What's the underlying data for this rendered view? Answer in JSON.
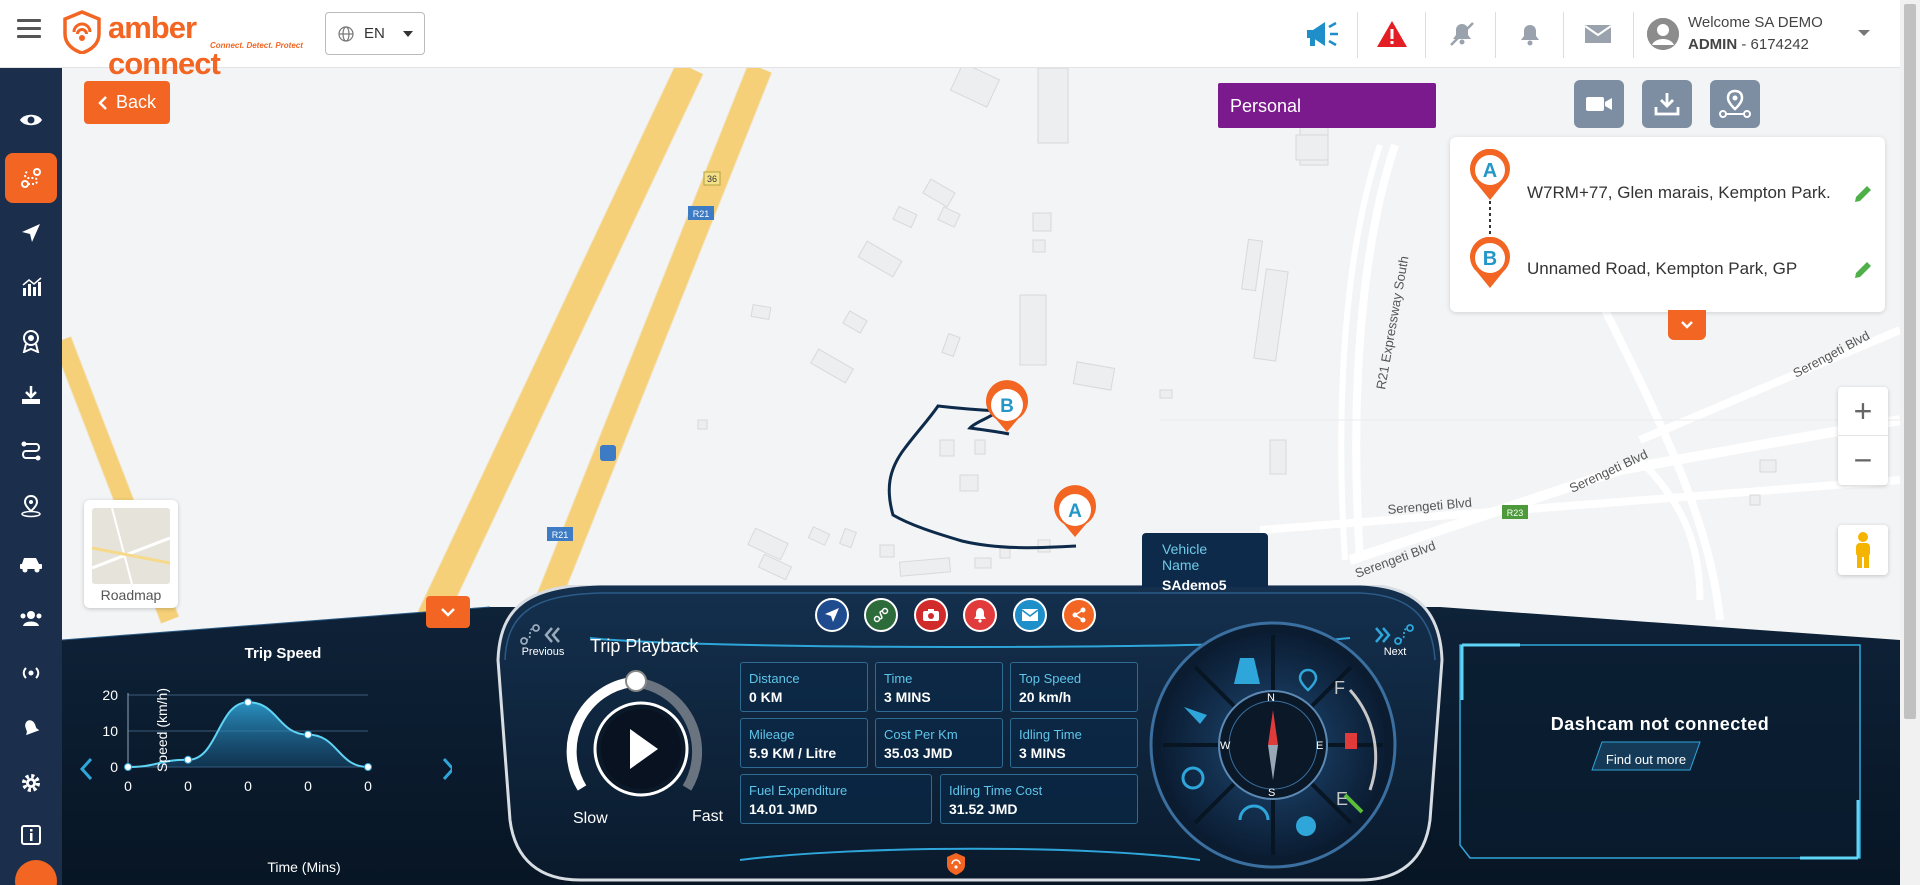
{
  "header": {
    "brand": "amber connect",
    "tagline": "Connect. Detect. Protect",
    "language": "EN",
    "welcome": "Welcome SA DEMO",
    "role": "ADMIN",
    "account": "- 6174242"
  },
  "map": {
    "back_label": "Back",
    "trip_tag": "Personal",
    "start_marker": "A",
    "end_marker": "B",
    "start_address": "W7RM+77, Glen marais, Kempton Park.",
    "end_address": "Unnamed Road, Kempton Park, GP",
    "roadmap_label": "Roadmap",
    "zoom_in": "+",
    "zoom_out": "−",
    "labels": {
      "r21_a": "R21",
      "r21_b": "R21",
      "r36": "36",
      "r21_express": "R21 Expressway South",
      "serengeti1": "Serengeti Blvd",
      "serengeti2": "Serengeti Blvd",
      "serengeti3": "Serengeti Blvd",
      "serengeti4": "Serengeti Blvd",
      "r23": "R23"
    }
  },
  "vehicle": {
    "label": "Vehicle Name",
    "name": "SAdemo5"
  },
  "chart_data": {
    "type": "line",
    "title": "Trip Speed",
    "xlabel": "Time (Mins)",
    "ylabel": "Speed (km/h)",
    "x": [
      "0",
      "0",
      "0",
      "0",
      "0"
    ],
    "values": [
      0,
      2,
      18,
      9,
      0
    ],
    "ylim": [
      0,
      20
    ],
    "yticks": [
      "0",
      "10",
      "20"
    ],
    "grid": true
  },
  "playback": {
    "title": "Trip Playback",
    "previous": "Previous",
    "next": "Next",
    "slow": "Slow",
    "fast": "Fast"
  },
  "stats": {
    "distance": {
      "label": "Distance",
      "value": "0 KM"
    },
    "time": {
      "label": "Time",
      "value": "3 MINS"
    },
    "top_speed": {
      "label": "Top Speed",
      "value": "20 km/h"
    },
    "mileage": {
      "label": "Mileage",
      "value": "5.9 KM / Litre"
    },
    "cost_per_km": {
      "label": "Cost Per Km",
      "value": "35.03 JMD"
    },
    "idling_time": {
      "label": "Idling Time",
      "value": "3 MINS"
    },
    "fuel_expenditure": {
      "label": "Fuel Expenditure",
      "value": "14.01 JMD"
    },
    "idling_cost": {
      "label": "Idling Time Cost",
      "value": "31.52 JMD"
    }
  },
  "gauge": {
    "n": "N",
    "s": "S",
    "e": "E",
    "w": "W",
    "fuel_full": "F",
    "fuel_empty": "E"
  },
  "dashcam": {
    "message": "Dashcam not connected",
    "link": "Find out more"
  },
  "colors": {
    "brand": "#f26522",
    "sidebar": "#1b2f4d",
    "trip_tag": "#7a1a8c",
    "route": "#0d2a4a"
  }
}
